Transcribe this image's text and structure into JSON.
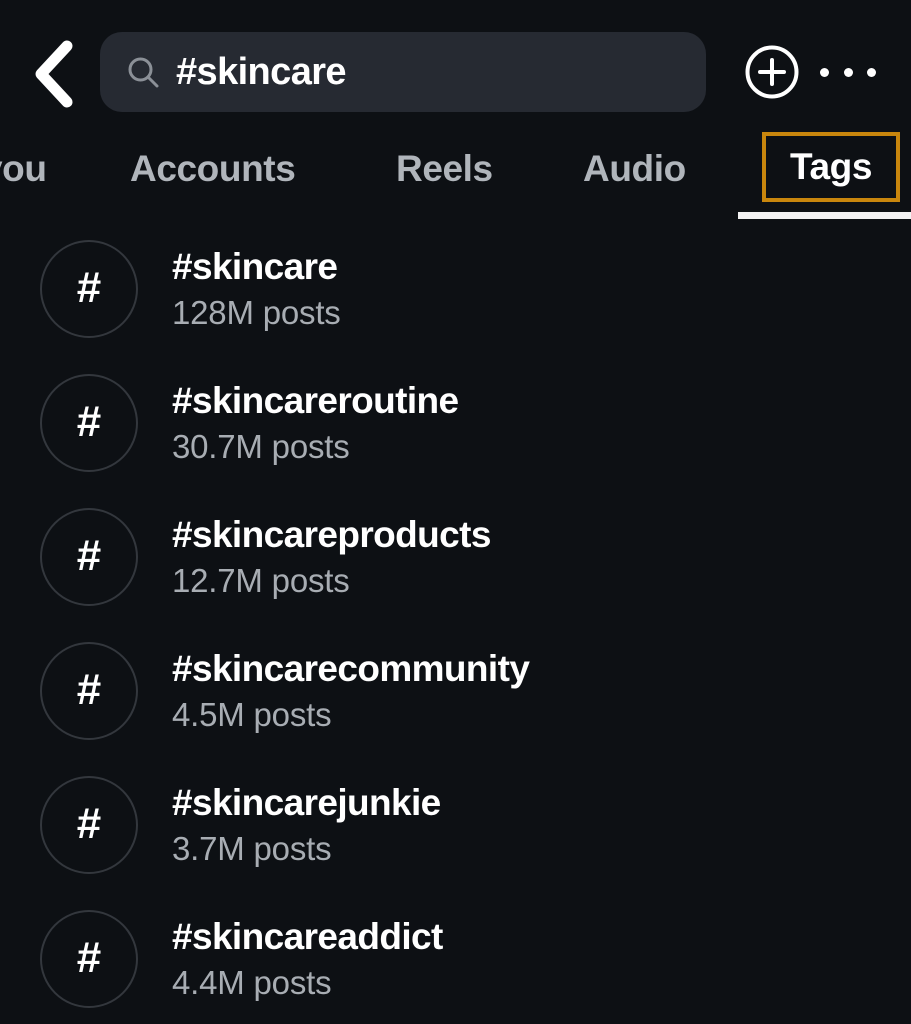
{
  "screen": {
    "app": "Instagram",
    "background_color": "#0d1014",
    "accent_color": "#c8860d"
  },
  "topbar": {
    "back_icon": "chevron-left-icon",
    "search": {
      "icon": "search-icon",
      "value": "#skincare",
      "placeholder": "Search"
    },
    "add_icon": "plus-circle-icon",
    "more_icon": "more-options-icon"
  },
  "tabs": {
    "items": [
      {
        "label": "you",
        "active": false,
        "truncated": true
      },
      {
        "label": "Accounts",
        "active": false
      },
      {
        "label": "Reels",
        "active": false
      },
      {
        "label": "Audio",
        "active": false
      },
      {
        "label": "Tags",
        "active": true
      }
    ],
    "active_label": "Tags",
    "active_color": "#ffffff",
    "inactive_color": "#b0b5bb",
    "highlight_border_color": "#c8860d",
    "underline_color": "#f2f2f2"
  },
  "results": {
    "icon": "hashtag-icon",
    "items": [
      {
        "tag": "#skincare",
        "count": "128M posts"
      },
      {
        "tag": "#skincareroutine",
        "count": "30.7M posts"
      },
      {
        "tag": "#skincareproducts",
        "count": "12.7M posts"
      },
      {
        "tag": "#skincarecommunity",
        "count": "4.5M posts"
      },
      {
        "tag": "#skincarejunkie",
        "count": "3.7M posts"
      },
      {
        "tag": "#skincareaddict",
        "count": "4.4M posts"
      }
    ]
  }
}
